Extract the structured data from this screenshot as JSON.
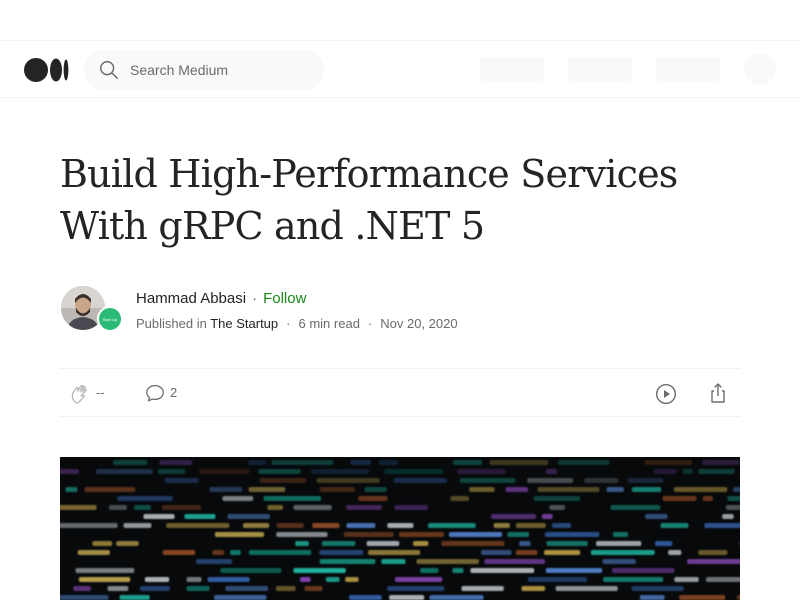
{
  "navbar": {
    "logo": "medium-logo",
    "search": {
      "placeholder": "Search Medium",
      "value": "",
      "icon": "search-icon"
    }
  },
  "article": {
    "title_line1": "Build High-Performance Services",
    "title_line2": "With gRPC and .NET 5",
    "author": {
      "name": "Hammad Abbasi",
      "follow_label": "Follow",
      "separator": "·"
    },
    "meta": {
      "published_in_label": "Published in",
      "publication": "The Startup",
      "read_time": "6 min read",
      "date": "Nov 20, 2020",
      "separator": "·"
    },
    "actions": {
      "clap_count": "--",
      "comment_count": "2"
    }
  },
  "colors": {
    "accent_follow": "#1a8917",
    "text_primary": "#242424",
    "text_secondary": "#6b6b6b",
    "publication_badge": "#2bbb77"
  }
}
